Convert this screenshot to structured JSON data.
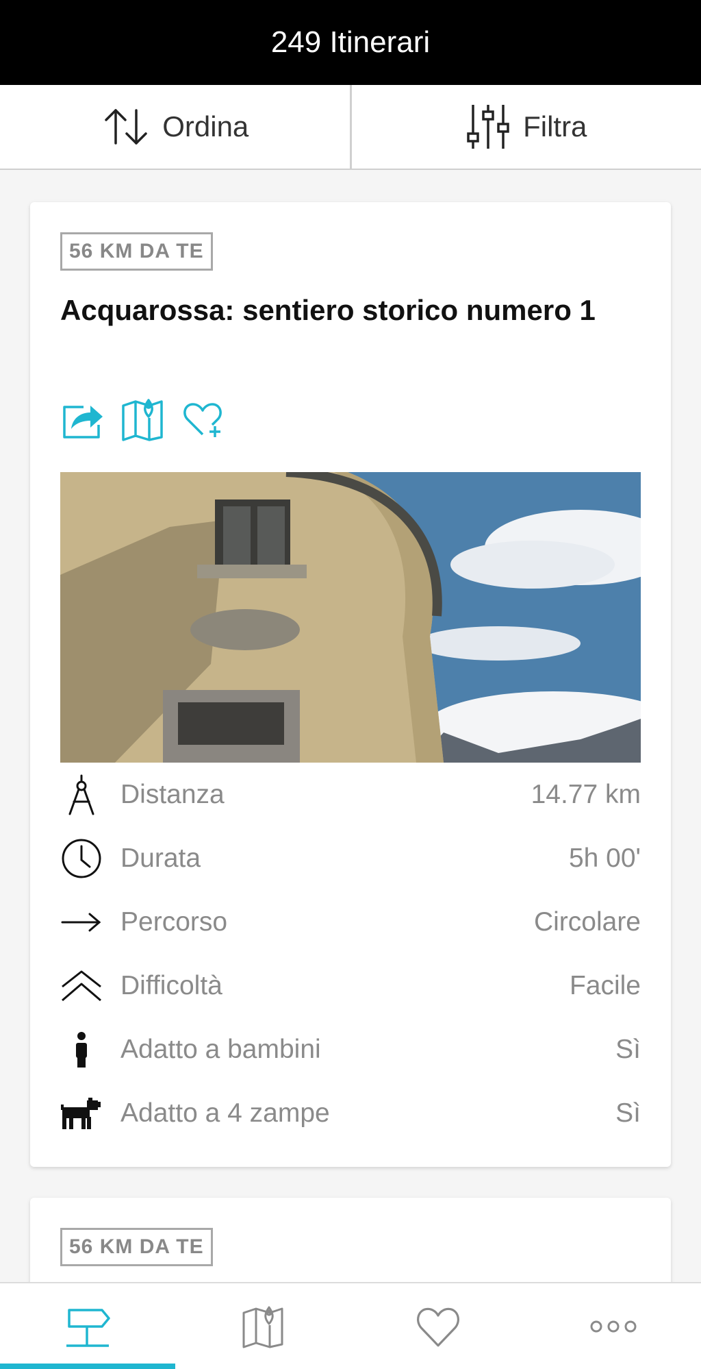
{
  "header": {
    "title": "249 Itinerari"
  },
  "toolbar": {
    "sort_label": "Ordina",
    "filter_label": "Filtra"
  },
  "accent_color": "#1fb6d0",
  "cards": [
    {
      "distance_badge": "56 KM DA TE",
      "title": "Acquarossa: sentiero storico numero 1",
      "actions": [
        "share-icon",
        "map-icon",
        "favorite-add-icon"
      ],
      "details": [
        {
          "icon": "compass-icon",
          "label": "Distanza",
          "value": "14.77 km"
        },
        {
          "icon": "clock-icon",
          "label": "Durata",
          "value": "5h 00'"
        },
        {
          "icon": "arrow-right-icon",
          "label": "Percorso",
          "value": "Circolare"
        },
        {
          "icon": "double-chevron-up-icon",
          "label": "Difficoltà",
          "value": "Facile"
        },
        {
          "icon": "person-icon",
          "label": "Adatto a bambini",
          "value": "Sì"
        },
        {
          "icon": "dog-icon",
          "label": "Adatto a 4 zampe",
          "value": "Sì"
        }
      ]
    },
    {
      "distance_badge": "56 KM DA TE"
    }
  ],
  "tabbar": {
    "tabs": [
      "itineraries-icon",
      "map-icon",
      "heart-icon",
      "more-icon"
    ],
    "active": 0
  }
}
